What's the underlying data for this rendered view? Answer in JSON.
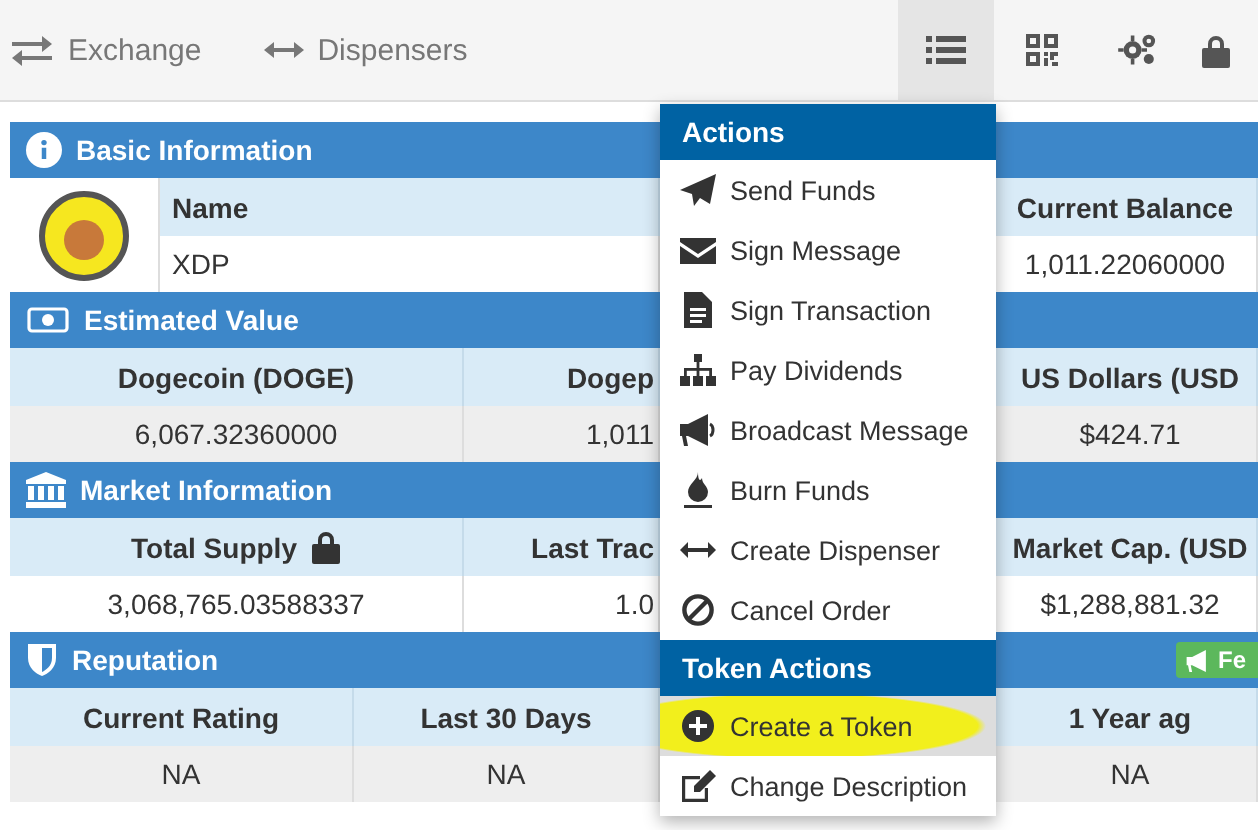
{
  "nav": {
    "links": [
      {
        "label": "Exchange"
      },
      {
        "label": "Dispensers"
      }
    ],
    "tools": [
      {
        "selected": true
      },
      {
        "selected": false
      },
      {
        "selected": false
      },
      {
        "selected": false
      }
    ]
  },
  "sections": [
    {
      "kind": "basic",
      "title": "Basic Information",
      "columns": [
        {
          "label": "Name"
        },
        {
          "label": "Current Balance"
        }
      ],
      "rows": [
        {
          "shaded": false,
          "cells": [
            "XDP",
            "1,011.22060000"
          ]
        }
      ]
    },
    {
      "kind": "value",
      "title": "Estimated Value",
      "columns": [
        {
          "label": "Dogecoin (DOGE)"
        },
        {
          "label": "Dogep"
        },
        {
          "label": "US Dollars (USD"
        }
      ],
      "rows": [
        {
          "shaded": true,
          "cells": [
            "6,067.32360000",
            "1,011",
            "$424.71"
          ]
        }
      ]
    },
    {
      "kind": "market",
      "title": "Market Information",
      "columns": [
        {
          "label": "Total Supply",
          "locked": true
        },
        {
          "label": "Last Trac",
          "locked": false
        },
        {
          "label": "Market Cap. (USD",
          "locked": false
        }
      ],
      "rows": [
        {
          "shaded": false,
          "cells": [
            "3,068,765.03588337",
            "1.0",
            "$1,288,881.32"
          ]
        }
      ]
    },
    {
      "kind": "reputation",
      "title": "Reputation",
      "badge": "Fe",
      "columns": [
        {
          "label": "Current Rating"
        },
        {
          "label": "Last 30 Days"
        },
        {
          "label": "1 Year ag"
        }
      ],
      "rows": [
        {
          "shaded": true,
          "cells": [
            "NA",
            "NA",
            "NA"
          ]
        }
      ]
    }
  ],
  "menu": {
    "groups": [
      {
        "title": "Actions",
        "items": [
          {
            "label": "Send Funds",
            "selected": false,
            "highlighted": false
          },
          {
            "label": "Sign Message",
            "selected": false,
            "highlighted": false
          },
          {
            "label": "Sign Transaction",
            "selected": false,
            "highlighted": false
          },
          {
            "label": "Pay Dividends",
            "selected": false,
            "highlighted": false
          },
          {
            "label": "Broadcast Message",
            "selected": false,
            "highlighted": false
          },
          {
            "label": "Burn Funds",
            "selected": false,
            "highlighted": false
          },
          {
            "label": "Create Dispenser",
            "selected": false,
            "highlighted": false
          },
          {
            "label": "Cancel Order",
            "selected": false,
            "highlighted": false
          }
        ]
      },
      {
        "title": "Token Actions",
        "items": [
          {
            "label": "Create a Token",
            "selected": true,
            "highlighted": true
          },
          {
            "label": "Change Description",
            "selected": false,
            "highlighted": false
          }
        ]
      }
    ]
  }
}
